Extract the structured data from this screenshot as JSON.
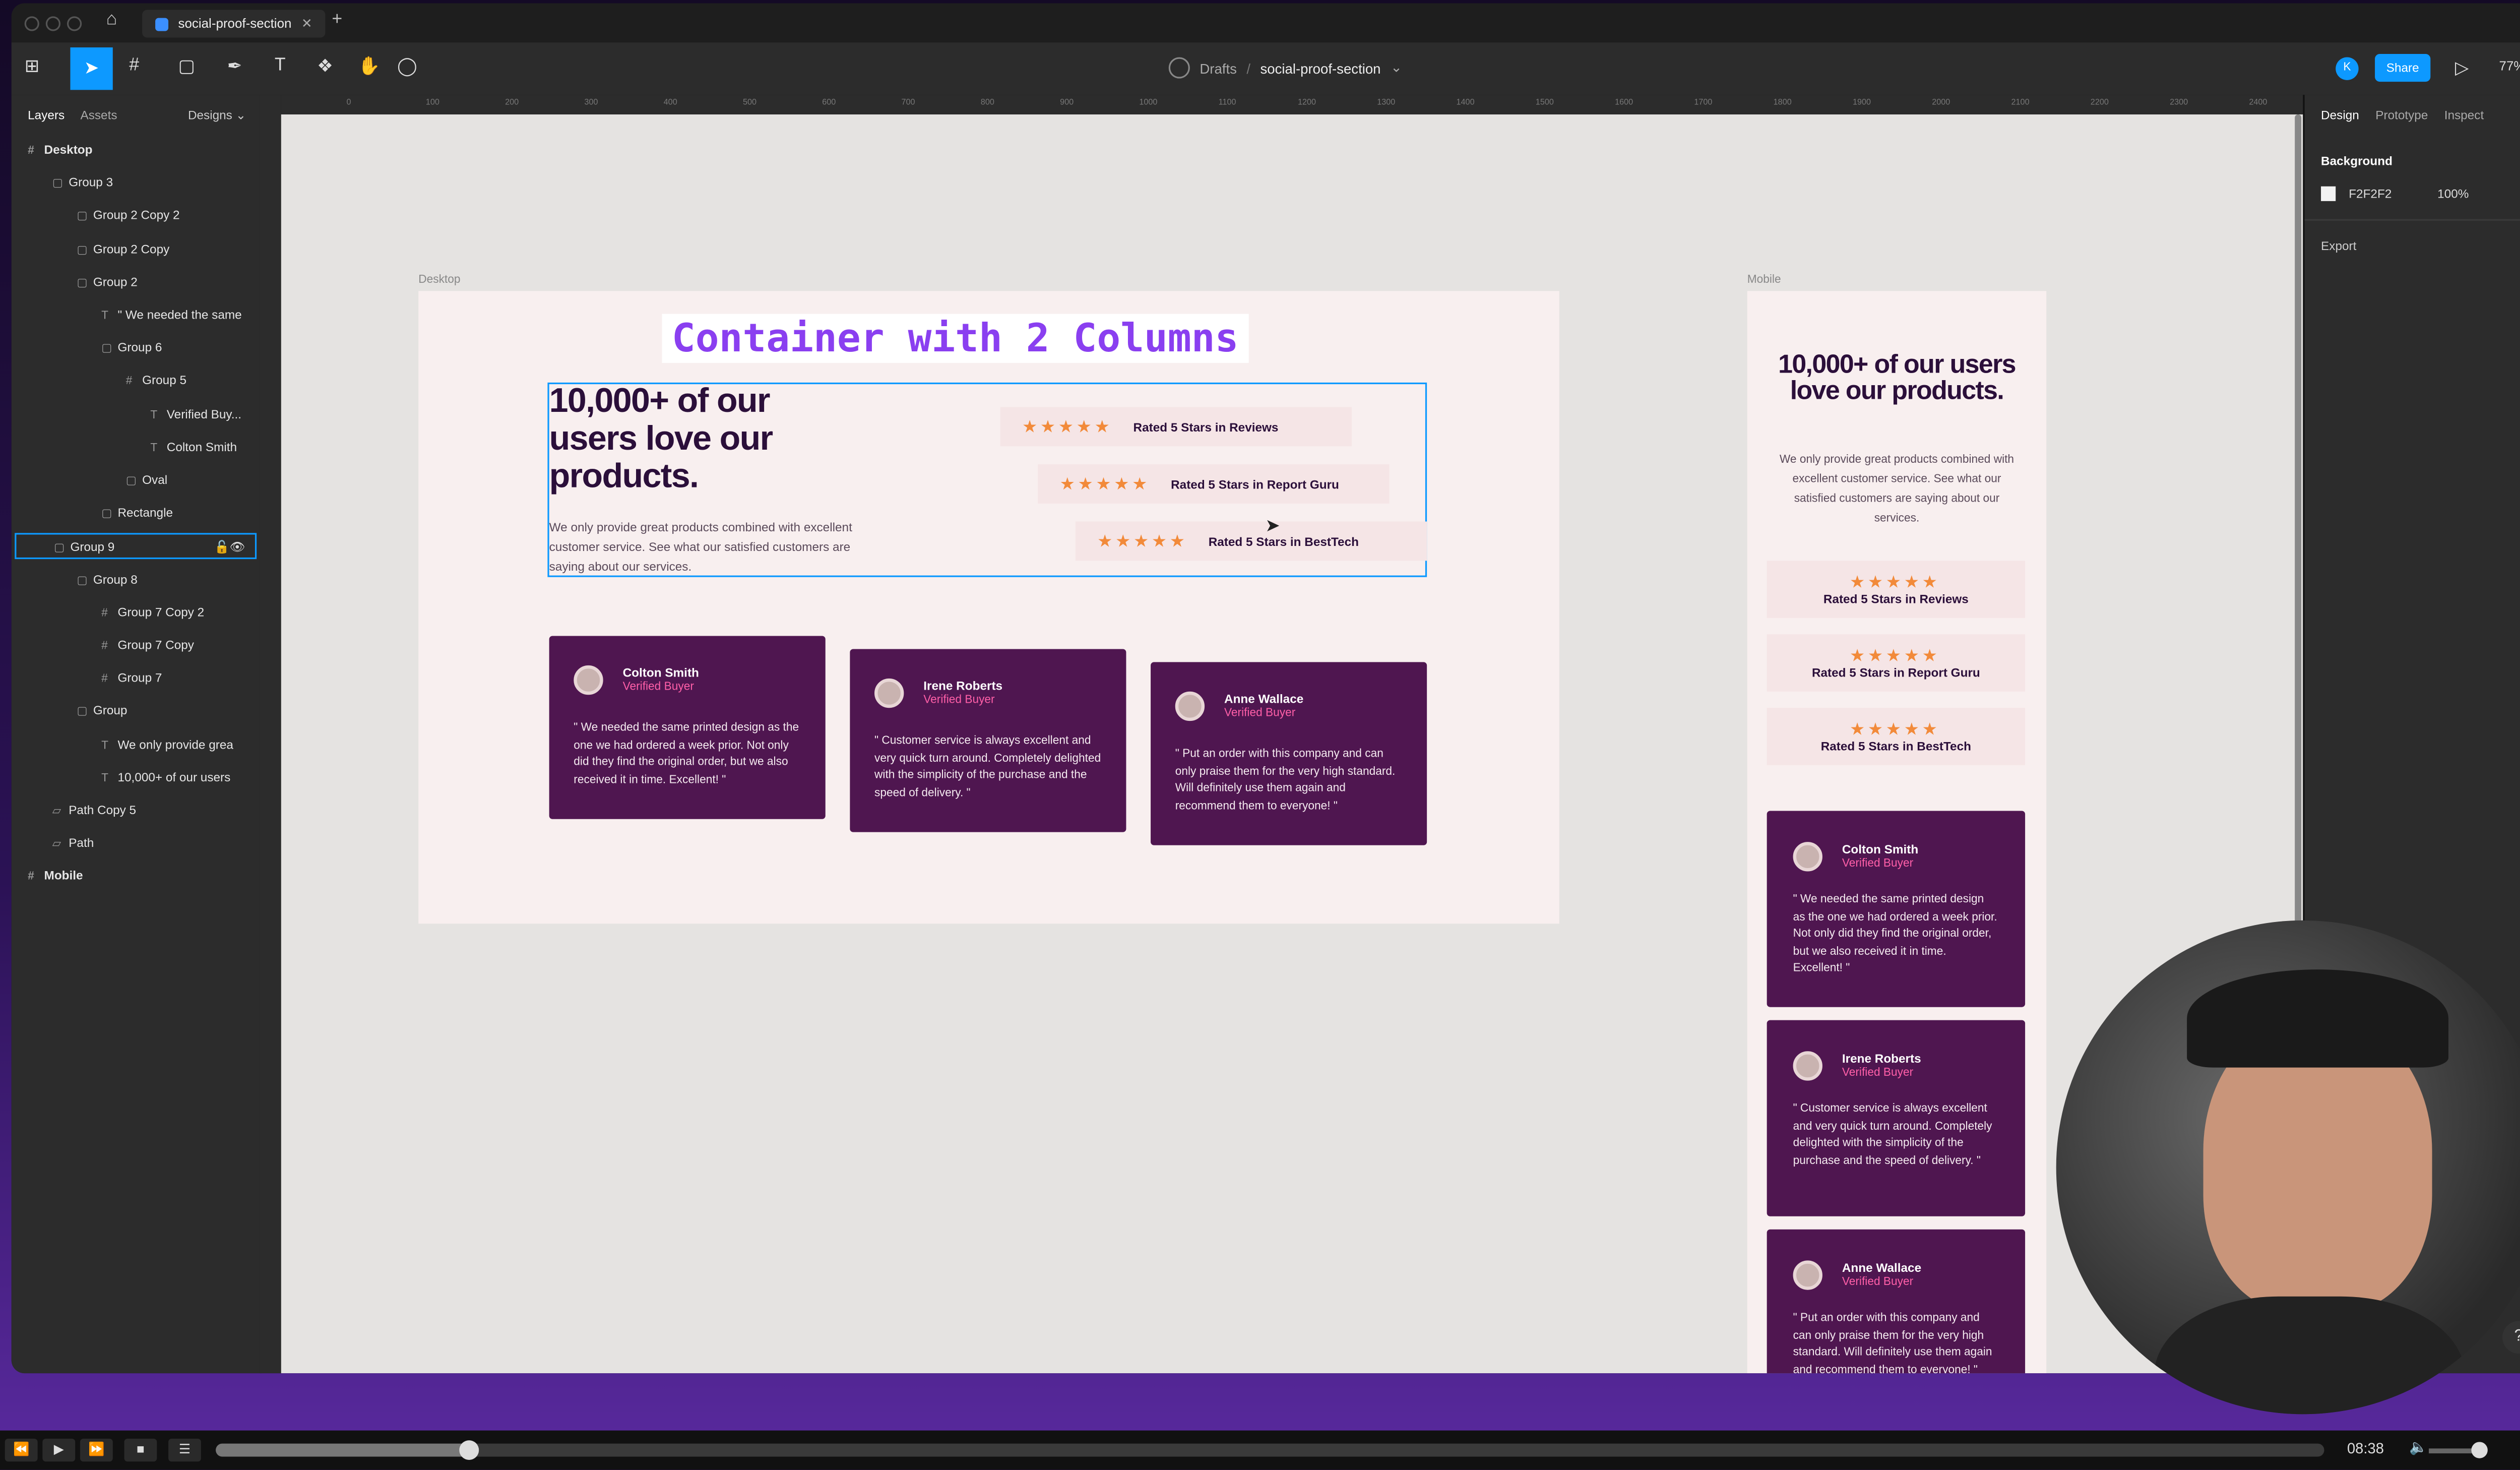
{
  "window": {
    "tab_title": "social-proof-section",
    "breadcrumb_drafts": "Drafts",
    "breadcrumb_separator": "/",
    "breadcrumb_file": "social-proof-section",
    "share_label": "Share",
    "avatar_initial": "K",
    "zoom": "77%"
  },
  "left_panel": {
    "tabs": [
      "Layers",
      "Assets"
    ],
    "page_selector": "Designs",
    "layers": [
      {
        "label": "Desktop",
        "indent": 0,
        "icon": "#"
      },
      {
        "label": "Group 3",
        "indent": 1,
        "icon": "▢"
      },
      {
        "label": "Group 2 Copy 2",
        "indent": 2,
        "icon": "▢"
      },
      {
        "label": "Group 2 Copy",
        "indent": 2,
        "icon": "▢"
      },
      {
        "label": "Group 2",
        "indent": 2,
        "icon": "▢"
      },
      {
        "label": "\" We needed the same",
        "indent": 3,
        "icon": "T"
      },
      {
        "label": "Group 6",
        "indent": 3,
        "icon": "▢"
      },
      {
        "label": "Group 5",
        "indent": 4,
        "icon": "#"
      },
      {
        "label": "Verified Buy...",
        "indent": 5,
        "icon": "T"
      },
      {
        "label": "Colton Smith",
        "indent": 5,
        "icon": "T"
      },
      {
        "label": "Oval",
        "indent": 4,
        "icon": "▢"
      },
      {
        "label": "Rectangle",
        "indent": 3,
        "icon": "▢"
      },
      {
        "label": "Group 9",
        "indent": 1,
        "icon": "▢",
        "selected": true
      },
      {
        "label": "Group 8",
        "indent": 2,
        "icon": "▢"
      },
      {
        "label": "Group 7 Copy 2",
        "indent": 3,
        "icon": "#"
      },
      {
        "label": "Group 7 Copy",
        "indent": 3,
        "icon": "#"
      },
      {
        "label": "Group 7",
        "indent": 3,
        "icon": "#"
      },
      {
        "label": "Group",
        "indent": 2,
        "icon": "▢"
      },
      {
        "label": "We only provide grea",
        "indent": 3,
        "icon": "T"
      },
      {
        "label": "10,000+ of our users",
        "indent": 3,
        "icon": "T"
      },
      {
        "label": "Path Copy 5",
        "indent": 1,
        "icon": "▱"
      },
      {
        "label": "Path",
        "indent": 1,
        "icon": "▱"
      },
      {
        "label": "Mobile",
        "indent": 0,
        "icon": "#"
      }
    ]
  },
  "right_panel": {
    "tabs": [
      "Design",
      "Prototype",
      "Inspect"
    ],
    "background_label": "Background",
    "bg_hex": "F2F2F2",
    "bg_opacity": "100%",
    "export_label": "Export"
  },
  "rulers": [
    "0",
    "100",
    "200",
    "300",
    "400",
    "500",
    "600",
    "700",
    "800",
    "900",
    "1000",
    "1100",
    "1200",
    "1300",
    "1400",
    "1500",
    "1600",
    "1700",
    "1800",
    "1900",
    "2000",
    "2100",
    "2200",
    "2300",
    "2400"
  ],
  "desktop": {
    "frame_label": "Desktop",
    "annotation": "Container with 2 Columns",
    "heading": "10,000+ of our users love our products.",
    "paragraph": "We only provide great products combined with excellent customer service. See what our satisfied customers are saying about our services.",
    "stars": "★★★★★",
    "ratings": [
      "Rated 5 Stars in Reviews",
      "Rated 5 Stars in Report Guru",
      "Rated 5 Stars in BestTech"
    ],
    "testimonials": [
      {
        "name": "Colton Smith",
        "role": "Verified Buyer",
        "quote": "\" We needed the same printed design as the one we had ordered a week prior. Not only did they find the original order, but we also received it in time. Excellent! \""
      },
      {
        "name": "Irene Roberts",
        "role": "Verified Buyer",
        "quote": "\" Customer service is always excellent and very quick turn around. Completely delighted with the simplicity of the purchase and the speed of delivery. \""
      },
      {
        "name": "Anne Wallace",
        "role": "Verified Buyer",
        "quote": "\" Put an order with this company and can only praise them for the very high standard. Will definitely use them again and recommend them to everyone! \""
      }
    ]
  },
  "mobile": {
    "frame_label": "Mobile"
  },
  "player": {
    "time": "08:38",
    "progress": 0.12
  },
  "colors": {
    "accent": "#0d99ff",
    "annotation": "#8a3ff0",
    "card": "#4f1650",
    "star": "#f28a3a",
    "role": "#ff5fa8"
  }
}
